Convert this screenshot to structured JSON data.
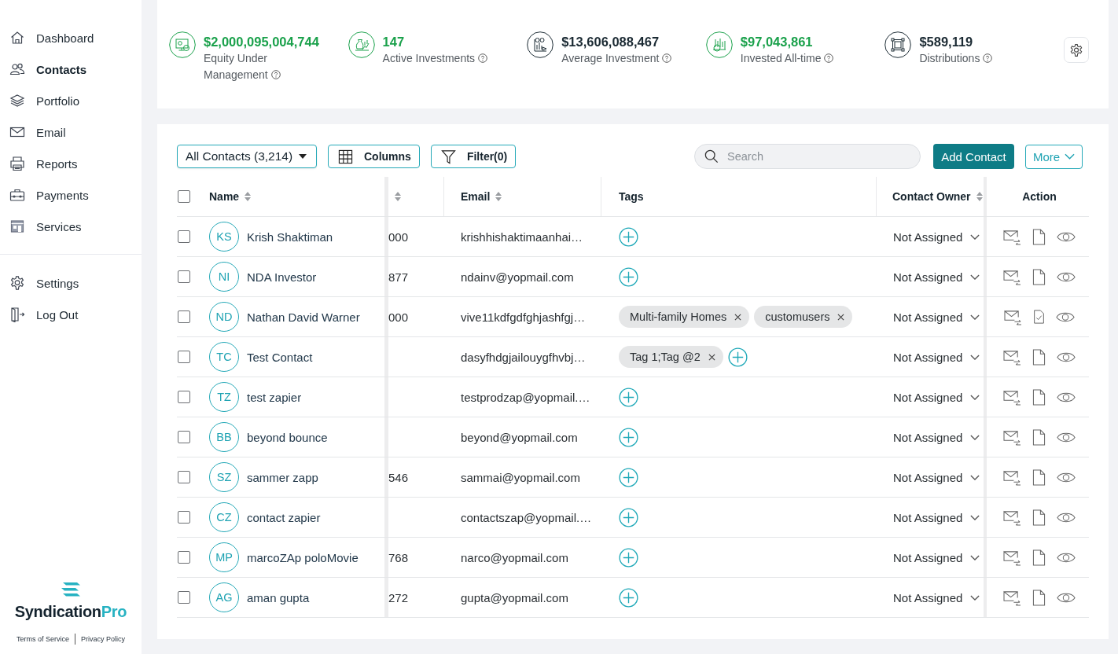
{
  "sidebar": {
    "main_items": [
      {
        "label": "Dashboard",
        "selected": false
      },
      {
        "label": "Contacts",
        "selected": true
      },
      {
        "label": "Portfolio",
        "selected": false
      },
      {
        "label": "Email",
        "selected": false
      },
      {
        "label": "Reports",
        "selected": false
      },
      {
        "label": "Payments",
        "selected": false
      },
      {
        "label": "Services",
        "selected": false
      }
    ],
    "account_items": [
      {
        "label": "Settings",
        "selected": false
      },
      {
        "label": "Log Out",
        "selected": false
      }
    ],
    "logo": {
      "text": "Syndication",
      "accent": "Pro"
    },
    "footer_links": [
      "Terms of Service",
      "Privacy Policy"
    ]
  },
  "stats": [
    {
      "value": "$2,000,095,004,744",
      "label": "Equity Under Management",
      "color": "#1aa14b"
    },
    {
      "value": "147",
      "label": "Active Investments",
      "color": "#1aa14b"
    },
    {
      "value": "$13,606,088,467",
      "label": "Average Investment",
      "color": "#1b2a33"
    },
    {
      "value": "$97,043,861",
      "label": "Invested All-time",
      "color": "#1aa14b"
    },
    {
      "value": "$589,119",
      "label": "Distributions",
      "color": "#1b2a33"
    }
  ],
  "toolbar": {
    "view_selector": "All Contacts (3,214)",
    "columns_button": "Columns",
    "filter_button": "Filter(0)",
    "search": {
      "placeholder": "Search"
    },
    "add_button": "Add Contact",
    "more_button": "More"
  },
  "table": {
    "select_all": {
      "checked": false
    },
    "columns": [
      {
        "label": "Name",
        "sortable": true
      },
      {
        "sortable": true
      },
      {
        "label": "Email",
        "sortable": true
      },
      {
        "label": "Tags",
        "sortable": false
      },
      {
        "label": "Contact Owner",
        "sortable": true
      },
      {
        "label": "Action",
        "sortable": false
      }
    ],
    "rows": [
      {
        "checked": false,
        "initials": "KS",
        "name": "Krish Shaktiman",
        "column_2": "000",
        "email": "krishhishaktimaanhai…",
        "tags": [],
        "add_tag": true,
        "owner": "Not Assigned",
        "document_signed": false
      },
      {
        "checked": false,
        "initials": "NI",
        "name": "NDA Investor",
        "column_2": "877",
        "email": "ndainv@yopmail.com",
        "tags": [],
        "add_tag": true,
        "owner": "Not Assigned",
        "document_signed": false
      },
      {
        "checked": false,
        "initials": "ND",
        "name": "Nathan David Warner",
        "column_2": "000",
        "email": "vive11kdfgdfghjashfgj…",
        "tags": [
          {
            "label": "Multi-family Homes"
          },
          {
            "label": "customusers"
          }
        ],
        "add_tag": false,
        "owner": "Not Assigned",
        "document_signed": true
      },
      {
        "checked": false,
        "initials": "TC",
        "name": "Test Contact",
        "email": "dasyfhdgjailouygfhvbj…",
        "tags": [
          {
            "label": "Tag 1;Tag @2"
          }
        ],
        "add_tag": true,
        "owner": "Not Assigned",
        "document_signed": false
      },
      {
        "checked": false,
        "initials": "TZ",
        "name": "test zapier",
        "email": "testprodzap@yopmail.…",
        "tags": [],
        "add_tag": true,
        "owner": "Not Assigned",
        "document_signed": false
      },
      {
        "checked": false,
        "initials": "BB",
        "name": "beyond bounce",
        "email": "beyond@yopmail.com",
        "tags": [],
        "add_tag": true,
        "owner": "Not Assigned",
        "document_signed": false
      },
      {
        "checked": false,
        "initials": "SZ",
        "name": "sammer zapp",
        "column_2": "546",
        "email": "sammai@yopmail.com",
        "tags": [],
        "add_tag": true,
        "owner": "Not Assigned",
        "document_signed": false
      },
      {
        "checked": false,
        "initials": "CZ",
        "name": "contact zapier",
        "email": "contactszap@yopmail.…",
        "tags": [],
        "add_tag": true,
        "owner": "Not Assigned",
        "document_signed": false
      },
      {
        "checked": false,
        "initials": "MP",
        "name": "marcoZAp poloMovie",
        "column_2": "768",
        "email": "narco@yopmail.com",
        "tags": [],
        "add_tag": true,
        "owner": "Not Assigned",
        "document_signed": false
      },
      {
        "checked": false,
        "initials": "AG",
        "name": "aman gupta",
        "column_2": "272",
        "email": "gupta@yopmail.com",
        "tags": [],
        "add_tag": true,
        "owner": "Not Assigned",
        "document_signed": false
      }
    ]
  }
}
